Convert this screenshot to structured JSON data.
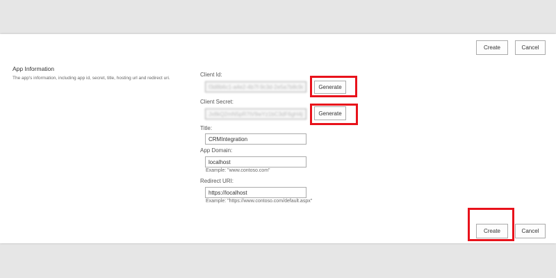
{
  "toolbar_top": {
    "create_label": "Create",
    "cancel_label": "Cancel"
  },
  "section": {
    "title": "App Information",
    "description": "The app's information, including app id, secret, title, hosting url and redirect uri."
  },
  "form": {
    "client_id": {
      "label": "Client Id:",
      "value": "f3d8b6c1-a4e2-4b7f-9c3d-2e5a7b8c9d0e",
      "generate_label": "Generate"
    },
    "client_secret": {
      "label": "Client Secret:",
      "value": "Jx8kQ2mN5pR7tV9wYz1bC3dF6gH4jL0s=",
      "generate_label": "Generate"
    },
    "title": {
      "label": "Title:",
      "value": "CRMIntegration"
    },
    "app_domain": {
      "label": "App Domain:",
      "value": "localhost",
      "example": "Example: \"www.contoso.com\""
    },
    "redirect_uri": {
      "label": "Redirect URI:",
      "value": "https://localhost",
      "example": "Example: \"https://www.contoso.com/default.aspx\""
    }
  },
  "toolbar_bottom": {
    "create_label": "Create",
    "cancel_label": "Cancel"
  },
  "colors": {
    "highlight": "#e8121b",
    "page_background": "#e6e6e6",
    "panel_background": "#ffffff"
  }
}
